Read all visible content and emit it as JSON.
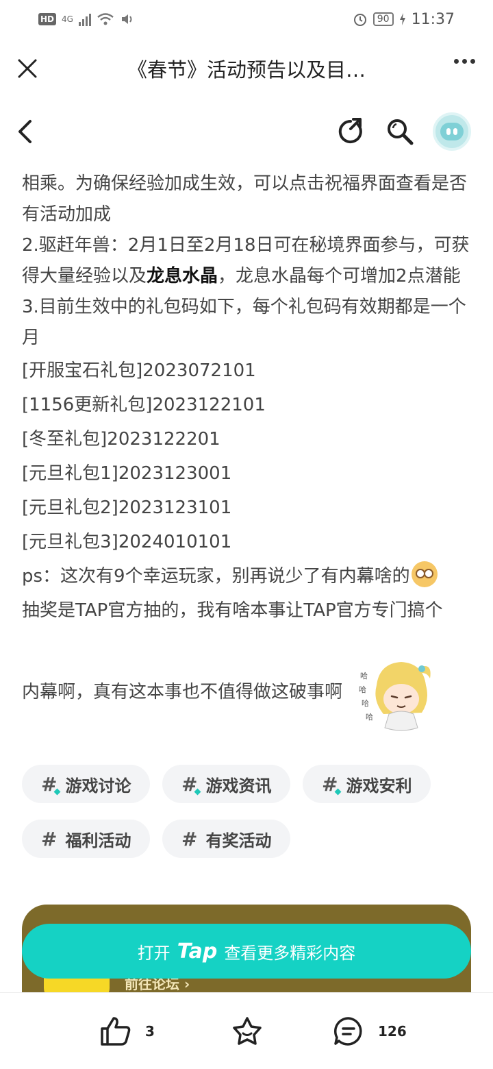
{
  "status_bar": {
    "hd": "HD",
    "network": "4G",
    "battery": "90",
    "time": "11:37"
  },
  "title_bar": {
    "title": "《春节》活动预告以及目…"
  },
  "content": {
    "p1_a": "相乘。为确保经验加成生效，可以点击祝福界面查看是否有活动加成",
    "p2_a": "2.驱赶年兽：2月1日至2月18日可在秘境界面参与，可获得大量经验以及",
    "p2_bold": "龙息水晶",
    "p2_b": "，龙息水晶每个可增加2点潜能",
    "p3": "3.目前生效中的礼包码如下，每个礼包码有效期都是一个月",
    "codes": [
      "[开服宝石礼包]2023072101",
      "[1156更新礼包]2023122101",
      "[冬至礼包]2023122201",
      "[元旦礼包1]2023123001",
      "[元旦礼包2]2023123101",
      "[元旦礼包3]2024010101"
    ],
    "ps": "ps：这次有9个幸运玩家，别再说少了有内幕啥的",
    "lottery_1": "抽奖是TAP官方抽的，我有啥本事让TAP官方专门搞个",
    "lottery_2": "内幕啊，真有这本事也不值得做这破事啊"
  },
  "tags": [
    "游戏讨论",
    "游戏资讯",
    "游戏安利",
    "福利活动",
    "有奖活动"
  ],
  "forum_card": {
    "link": "前往论坛 ›"
  },
  "open_button": {
    "prefix": "打开",
    "brand": "Tap",
    "suffix": "查看更多精彩内容"
  },
  "actions": {
    "like_count": "3",
    "comment_count": "126"
  },
  "colors": {
    "accent": "#15d2c4",
    "forum_card": "#7d6a2a",
    "tag_bg": "#f3f4f6"
  }
}
